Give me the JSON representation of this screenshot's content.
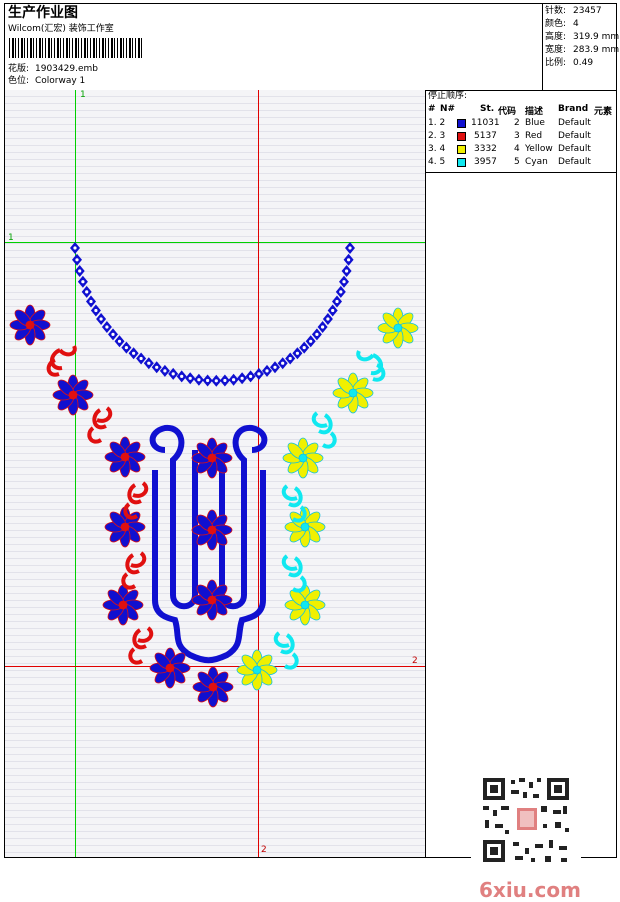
{
  "header": {
    "title": "生产作业图",
    "company": "Wilcom(汇宏) 装饰工作室",
    "file_label": "花版:",
    "file_name": "1903429.emb",
    "colorway_label": "色位:",
    "colorway": "Colorway 1"
  },
  "stats": [
    {
      "label": "针数:",
      "value": "23457"
    },
    {
      "label": "颜色:",
      "value": "4"
    },
    {
      "label": "高度:",
      "value": "319.9 mm"
    },
    {
      "label": "宽度:",
      "value": "283.9 mm"
    },
    {
      "label": "比例:",
      "value": "0.49"
    }
  ],
  "legend": {
    "title": "停止顺序:",
    "headers": [
      "#",
      "N#",
      "St.",
      "代码",
      "描述",
      "Brand",
      "元素"
    ],
    "rows": [
      {
        "num": "1. 2",
        "stitches": "11031",
        "code": "2",
        "desc": "Blue",
        "brand": "Default",
        "color": "#1010d0"
      },
      {
        "num": "2. 3",
        "stitches": "5137",
        "code": "3",
        "desc": "Red",
        "brand": "Default",
        "color": "#e01010"
      },
      {
        "num": "3. 4",
        "stitches": "3332",
        "code": "4",
        "desc": "Yellow",
        "brand": "Default",
        "color": "#f0f000"
      },
      {
        "num": "4. 5",
        "stitches": "3957",
        "code": "5",
        "desc": "Cyan",
        "brand": "Default",
        "color": "#10e8f0"
      }
    ]
  },
  "guides": {
    "green_v_label": "1",
    "green_h_label": "1",
    "red_h_label": "2",
    "red_v_label": "2"
  },
  "colors": {
    "blue": "#1010d0",
    "red": "#e01010",
    "yellow": "#f0f000",
    "cyan": "#10e8f0",
    "green_guide": "#00d000",
    "red_guide": "#e00000"
  },
  "watermark": "6xiu.com"
}
